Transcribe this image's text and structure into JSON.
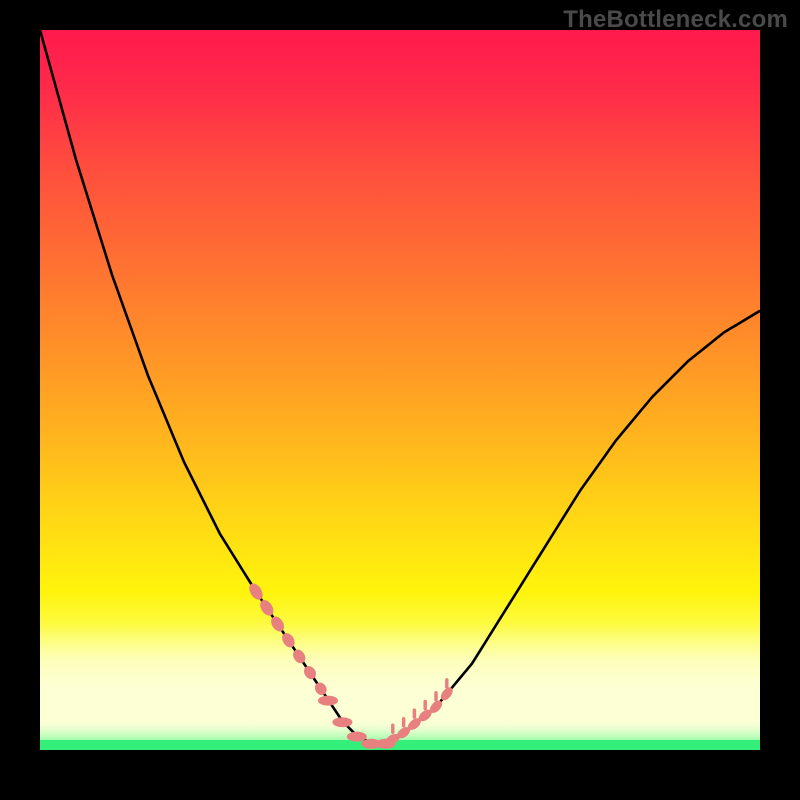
{
  "watermark": "TheBottleneck.com",
  "colors": {
    "background": "#000000",
    "gradient_top": "#ff1a4d",
    "gradient_bottom_green": "#34f07a",
    "curve": "#000000",
    "marker": "#e98080",
    "watermark": "#4a4a4a"
  },
  "chart_data": {
    "type": "line",
    "title": "",
    "xlabel": "",
    "ylabel": "",
    "xlim": [
      0,
      100
    ],
    "ylim": [
      0,
      100
    ],
    "x": [
      0,
      5,
      10,
      15,
      20,
      25,
      30,
      32,
      34,
      36,
      38,
      40,
      42,
      44,
      46,
      48,
      50,
      55,
      60,
      65,
      70,
      75,
      80,
      85,
      90,
      95,
      100
    ],
    "y": [
      100,
      82,
      66,
      52,
      40,
      30,
      22,
      19,
      16,
      13,
      10,
      7,
      4,
      2,
      1,
      1,
      2,
      6,
      12,
      20,
      28,
      36,
      43,
      49,
      54,
      58,
      61
    ],
    "notes": "Axes are unlabeled; values are normalized to a 0–100 range read from the plot area. The curve descends steeply from the top-left, reaches a broad minimum near x≈45, then rises toward the upper-right. Salmon-colored markers/ticks cluster along the curve near the minimum on both sides.",
    "markers": {
      "left_cluster_x": [
        30,
        31.5,
        33,
        34.5,
        36,
        37.5,
        39
      ],
      "right_cluster_x": [
        49,
        50.5,
        52,
        53.5,
        55,
        56.5
      ],
      "bottom_strip_x": [
        40,
        42,
        44,
        46,
        48
      ]
    }
  }
}
